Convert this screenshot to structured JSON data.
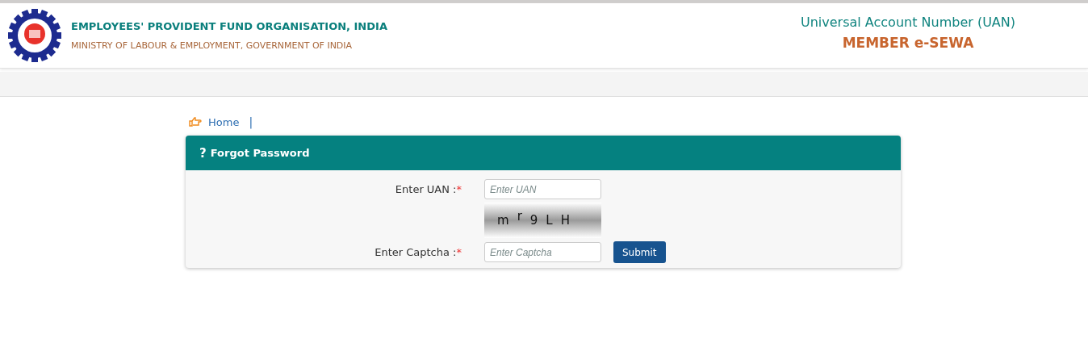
{
  "header": {
    "org_name": "EMPLOYEES' PROVIDENT FUND ORGANISATION, INDIA",
    "ministry": "MINISTRY OF LABOUR & EMPLOYMENT, GOVERNMENT OF INDIA",
    "portal_title": "Universal Account Number (UAN)",
    "portal_subtitle": "MEMBER e-SEWA"
  },
  "breadcrumb": {
    "home": "Home",
    "separator": "|"
  },
  "panel": {
    "icon_text": "?",
    "title": "Forgot Password",
    "uan": {
      "label": "Enter UAN :",
      "required_mark": "*",
      "placeholder": "Enter UAN"
    },
    "captcha_image": [
      {
        "char": "m",
        "raised": false
      },
      {
        "char": "r",
        "raised": true
      },
      {
        "char": "9",
        "raised": false
      },
      {
        "char": "L",
        "raised": false
      },
      {
        "char": "H",
        "raised": false
      }
    ],
    "captcha": {
      "label": "Enter Captcha :",
      "required_mark": "*",
      "placeholder": "Enter Captcha"
    },
    "submit": "Submit"
  }
}
